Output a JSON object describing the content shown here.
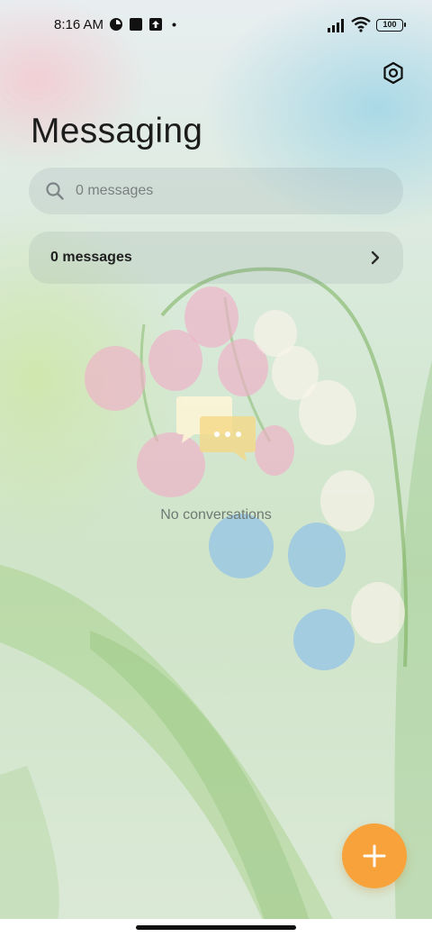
{
  "status_bar": {
    "time": "8:16 AM",
    "battery": "100",
    "icons": [
      "app-notification-icon",
      "square-notification-icon",
      "upload-notification-icon",
      "dot-icon",
      "signal-icon",
      "wifi-icon",
      "battery-icon"
    ]
  },
  "header": {
    "title": "Messaging",
    "settings_icon": "gear-icon"
  },
  "search": {
    "placeholder": "0 messages",
    "value": ""
  },
  "summary": {
    "label": "0 messages"
  },
  "empty_state": {
    "text": "No conversations",
    "icon": "chat-bubbles-icon"
  },
  "fab": {
    "icon": "plus-icon",
    "color": "#f7a23a"
  },
  "colors": {
    "accent": "#f7a23a"
  }
}
